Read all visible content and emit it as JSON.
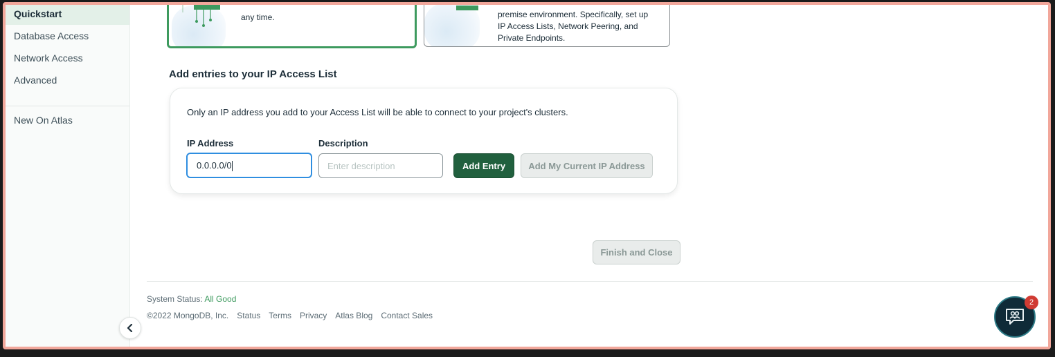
{
  "sidebar": {
    "items": [
      {
        "label": "Quickstart",
        "active": true
      },
      {
        "label": "Database Access"
      },
      {
        "label": "Network Access"
      },
      {
        "label": "Advanced"
      }
    ],
    "secondary": [
      {
        "label": "New On Atlas"
      }
    ]
  },
  "cards": {
    "local": {
      "text": "any time."
    },
    "cloud": {
      "text_lines": [
        "premise environment. Specifically, set up",
        "IP Access Lists, Network Peering, and",
        "Private Endpoints."
      ]
    }
  },
  "access_list": {
    "title": "Add entries to your IP Access List",
    "description": "Only an IP address you add to your Access List will be able to connect to your project's clusters.",
    "ip_label": "IP Address",
    "ip_value": "0.0.0.0/0",
    "desc_label": "Description",
    "desc_placeholder": "Enter description",
    "add_entry": "Add Entry",
    "add_current_ip": "Add My Current IP Address"
  },
  "finish_button": "Finish and Close",
  "footer": {
    "status_label": "System Status:",
    "status_value": "All Good",
    "copyright": "©2022 MongoDB, Inc.",
    "links": [
      "Status",
      "Terms",
      "Privacy",
      "Atlas Blog",
      "Contact Sales"
    ]
  },
  "chat": {
    "badge_count": "2"
  },
  "colors": {
    "accent": "#21603e",
    "selected_border": "#3d9a5e",
    "focus_blue": "#2f8ee0",
    "badge": "#d03b33"
  }
}
